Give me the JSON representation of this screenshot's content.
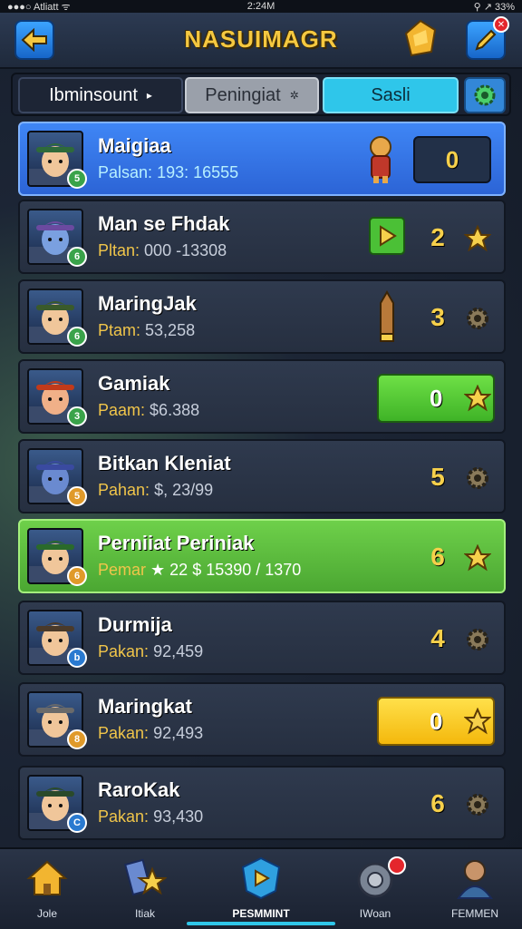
{
  "status_bar": {
    "carrier": "●●●○ Atliatt ᯤ",
    "time": "2:24M",
    "battery": "⚲ ↗ 33%"
  },
  "header": {
    "title": "NASUIMAGR",
    "back_icon": "back-arrow-icon",
    "gift_icon": "gift-icon",
    "edit_icon": "pencil-icon",
    "edit_badge": "✕"
  },
  "tabs": [
    {
      "label": "Ibminsount",
      "active": false
    },
    {
      "label": "Peningiat",
      "active": false
    },
    {
      "label": "Sasli",
      "active": true
    }
  ],
  "rows": [
    {
      "name": "Maigiaa",
      "score_label": "Palsan:",
      "score": "193: 16555",
      "value": "0",
      "style": "blue",
      "item": "character-toy-icon",
      "avatar_hair": "#2e6a3a",
      "avatar_skin": "#f0c69a",
      "chip": "5",
      "chip_color": "#3aa34a"
    },
    {
      "name": "Man se Fhdak",
      "score_label": "Pltan:",
      "score": "000 -13308",
      "value": "2",
      "style": "plain",
      "item": "play-card-icon",
      "trail_icon": "star-icon",
      "avatar_hair": "#6b4aa0",
      "avatar_skin": "#7aa0e0",
      "chip": "6",
      "chip_color": "#3aa34a"
    },
    {
      "name": "MaringJak",
      "score_label": "Ptam:",
      "score": "53,258",
      "value": "3",
      "style": "plain",
      "item": "pencil-item-icon",
      "trail_icon": "gear-icon",
      "avatar_hair": "#3a5a2a",
      "avatar_skin": "#f0c69a",
      "chip": "6",
      "chip_color": "#3aa34a"
    },
    {
      "name": "Gamiak",
      "score_label": "Paam:",
      "score": "$6.388",
      "value": "0",
      "style": "green",
      "trail_icon": "star-icon",
      "avatar_hair": "#c23a1a",
      "avatar_skin": "#f0b088",
      "chip": "3",
      "chip_color": "#3aa34a"
    },
    {
      "name": "Bitkan Kleniat",
      "score_label": "Pahan:",
      "score": "$, 23/99",
      "value": "5",
      "style": "plain",
      "trail_icon": "gear-icon",
      "avatar_hair": "#3a4aa0",
      "avatar_skin": "#6a8ad0",
      "chip": "5",
      "chip_color": "#e09a2a"
    },
    {
      "name": "Perniiat Periniak",
      "score_label": "Pemar",
      "score": "★ 22 $ 15390 / 1370",
      "value": "6",
      "style": "green-row",
      "trail_icon": "star-icon",
      "avatar_hair": "#2a6a2a",
      "avatar_skin": "#f0c69a",
      "chip": "6",
      "chip_color": "#e09a2a"
    },
    {
      "name": "Durmija",
      "score_label": "Pakan:",
      "score": "92,459",
      "value": "4",
      "style": "plain",
      "trail_icon": "gear-icon",
      "avatar_hair": "#4a3a2a",
      "avatar_skin": "#f0c69a",
      "chip": "b",
      "chip_color": "#2a7ad0"
    },
    {
      "name": "Maringkat",
      "score_label": "Pakan:",
      "score": "92,493",
      "value": "0",
      "style": "yellow",
      "trail_icon": "star-icon",
      "avatar_hair": "#6a6a6a",
      "avatar_skin": "#f0c69a",
      "chip": "8",
      "chip_color": "#e09a2a"
    },
    {
      "name": "RaroKak",
      "score_label": "Pakan:",
      "score": "93,430",
      "value": "6",
      "style": "plain",
      "trail_icon": "gear-icon",
      "avatar_hair": "#2a4a2a",
      "avatar_skin": "#f0c69a",
      "chip": "C",
      "chip_color": "#2a7ad0"
    }
  ],
  "nav": [
    {
      "label": "Jole",
      "icon": "home-icon"
    },
    {
      "label": "Itiak",
      "icon": "star-flag-icon"
    },
    {
      "label": "PESMMINT",
      "icon": "play-shield-icon",
      "active": true
    },
    {
      "label": "IWoan",
      "icon": "wheel-icon",
      "badge": true
    },
    {
      "label": "FEMMEN",
      "icon": "profile-icon"
    }
  ],
  "colors": {
    "accent_blue": "#2fc6ea",
    "gold": "#f6d04b",
    "green": "#4ba732",
    "highlight_blue": "#2c64d6"
  }
}
